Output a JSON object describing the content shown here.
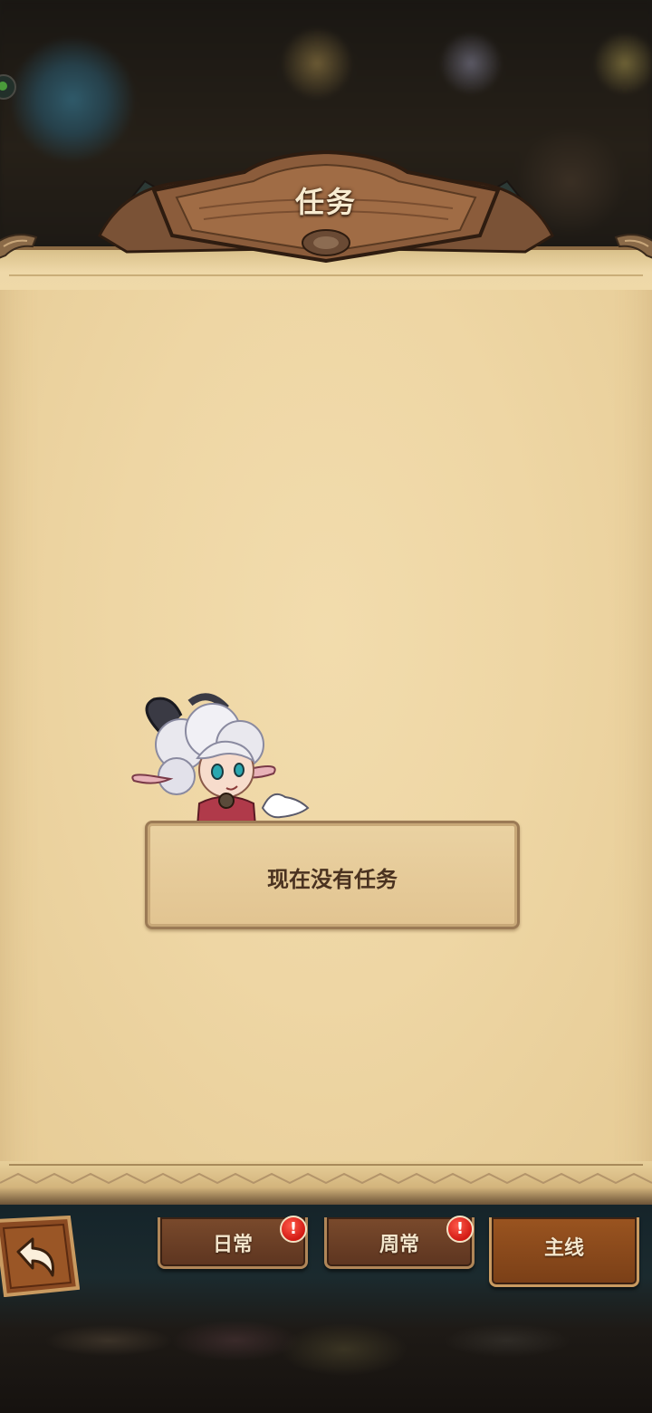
{
  "header": {
    "title": "任务"
  },
  "main": {
    "empty_message": "现在没有任务"
  },
  "tabs": [
    {
      "label": "日常",
      "alert": "!",
      "active": false
    },
    {
      "label": "周常",
      "alert": "!",
      "active": false
    },
    {
      "label": "主线",
      "active": true
    }
  ],
  "icons": {
    "back": "back-arrow-icon",
    "alert": "exclamation-icon",
    "character": "sheep-girl-character"
  },
  "colors": {
    "parchment": "#efd7a6",
    "title_text": "#f7ebd0",
    "tab_bg": "#6b3f25",
    "tab_active_bg": "#8a4a1c",
    "alert_red": "#d21a14"
  }
}
